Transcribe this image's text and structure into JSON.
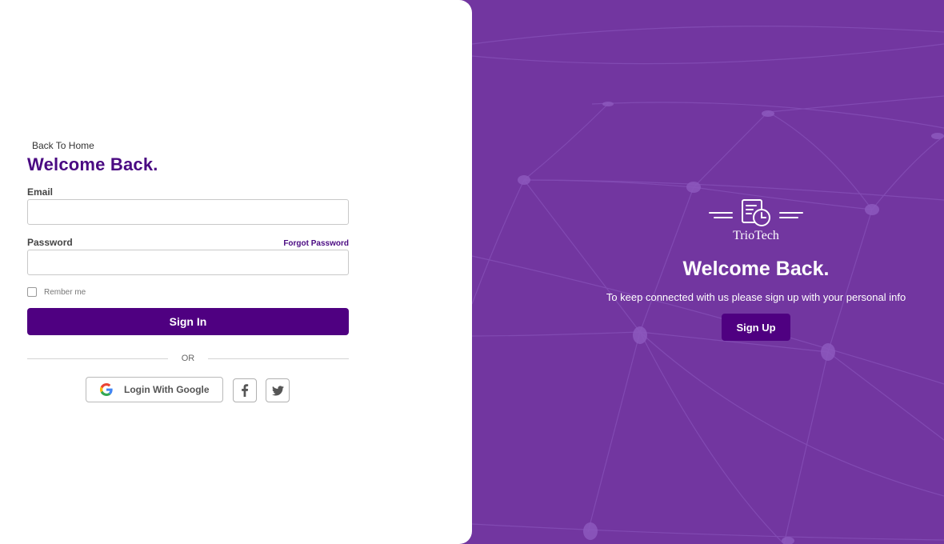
{
  "login": {
    "back_link": "Back To Home",
    "title": "Welcome Back.",
    "email_label": "Email",
    "email_value": "",
    "password_label": "Password",
    "password_value": "",
    "forgot_password": "Forgot Password",
    "remember_label": "Rember me",
    "remember_checked": false,
    "sign_in_label": "Sign In",
    "or_text": "OR",
    "google_label": "Login With Google",
    "social": [
      {
        "name": "facebook",
        "icon": "facebook-icon"
      },
      {
        "name": "twitter",
        "icon": "twitter-icon"
      }
    ]
  },
  "hero": {
    "brand_name": "TrioTech",
    "logo_icon": "document-clock-icon",
    "title": "Welcome Back.",
    "subtitle": "To keep connected with us please sign up with your personal info",
    "sign_up_label": "Sign Up"
  },
  "colors": {
    "primary": "#4f0081",
    "hero_background": "#7236a0",
    "title_purple": "#4a0a82",
    "panel_background": "#ffffff"
  }
}
